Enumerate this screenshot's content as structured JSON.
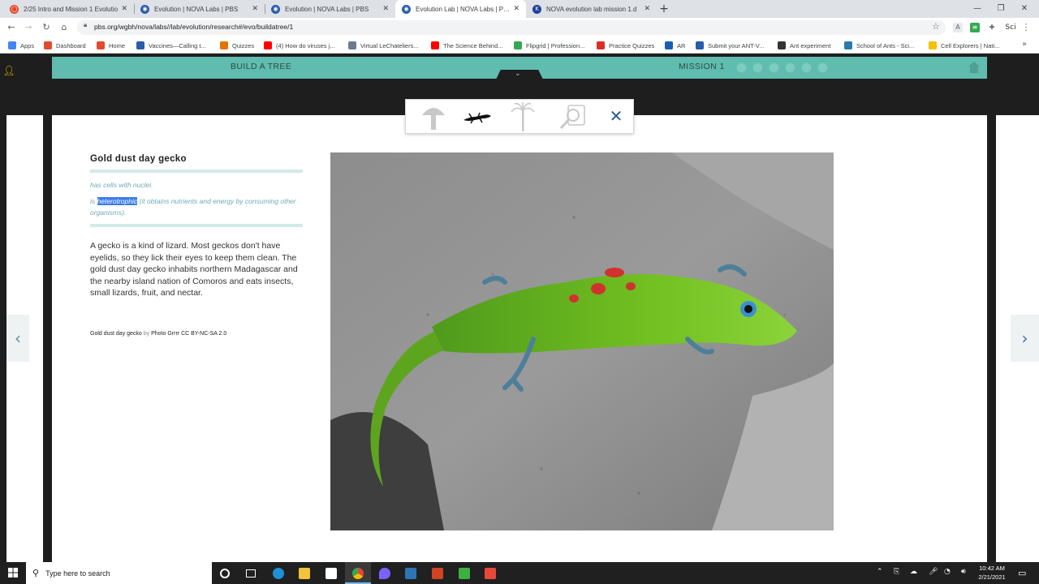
{
  "browser": {
    "tabs": [
      {
        "title": "2/25 Intro and Mission 1 Evolutio",
        "favicon_color": "#e34b2f",
        "favicon_glyph": "◯"
      },
      {
        "title": "Evolution | NOVA Labs | PBS",
        "favicon_color": "#2a5caa",
        "favicon_glyph": "◉"
      },
      {
        "title": "Evolution | NOVA Labs | PBS",
        "favicon_color": "#2a5caa",
        "favicon_glyph": "◉"
      },
      {
        "title": "Evolution Lab | NOVA Labs | PBS",
        "favicon_color": "#2a5caa",
        "favicon_glyph": "◉"
      },
      {
        "title": "NOVA evolution lab mission 1.d",
        "favicon_color": "#1d3f9c",
        "favicon_glyph": "K"
      }
    ],
    "active_tab": 3,
    "new_tab": "+",
    "window_controls": [
      "—",
      "❐",
      "✕"
    ],
    "url": "pbs.org/wgbh/nova/labs//lab/evolution/research#/evo/buildatree/1",
    "bookmarks": [
      {
        "label": "Apps",
        "color": "#4285f4"
      },
      {
        "label": "Dashboard",
        "color": "#e34b2f"
      },
      {
        "label": "Home",
        "color": "#e34b2f"
      },
      {
        "label": "Vaccines—Calling t...",
        "color": "#2a5caa"
      },
      {
        "label": "Quizzes",
        "color": "#e37400"
      },
      {
        "label": "(4) How do viruses j...",
        "color": "#ff0000"
      },
      {
        "label": "Virtual LeChateliers...",
        "color": "#6b7c8c"
      },
      {
        "label": "The Science Behind...",
        "color": "#ff0000"
      },
      {
        "label": "Flipgrid | Profession...",
        "color": "#34a853"
      },
      {
        "label": "Practice Quizzes",
        "color": "#d93025"
      },
      {
        "label": "AR",
        "color": "#1a5fb4"
      },
      {
        "label": "Submit your ANT-V...",
        "color": "#2a5caa"
      },
      {
        "label": "Ant experiment",
        "color": "#333333"
      },
      {
        "label": "School of Ants - Sci...",
        "color": "#2a7ab0"
      },
      {
        "label": "Cell Explorers | Nati...",
        "color": "#f2c200"
      }
    ]
  },
  "app": {
    "header_left": "BUILD A TREE",
    "header_right": "MISSION 1",
    "progress_dots": 6,
    "organism": {
      "name": "Gold dust day gecko",
      "trait_1": "has cells with nuclei.",
      "trait_2_prefix": "is ",
      "trait_2_highlight": "heterotrophic",
      "trait_2_suffix": " (it obtains nutrients and energy by consuming other organisms).",
      "description": "A gecko is a kind of lizard. Most geckos don't have eyelids, so they lick their eyes to keep them clean. The gold dust day gecko inhabits northern Madagascar and the nearby island nation of Comoros and eats insects, small lizards, fruit, and nectar.",
      "credit_name": "Gold dust day gecko",
      "credit_by": " by ",
      "credit_source": "Photo Grrrr CC BY-NC-SA 2.0"
    },
    "selector_close": "✕",
    "prev_arrow": "‹",
    "next_arrow": "›",
    "colors": {
      "teal": "#5fbcae",
      "accent_blue": "#2d5c8a",
      "highlight": "#3b7de9"
    }
  },
  "taskbar": {
    "search_placeholder": "Type here to search",
    "time": "10:42 AM",
    "date": "2/21/2021"
  }
}
